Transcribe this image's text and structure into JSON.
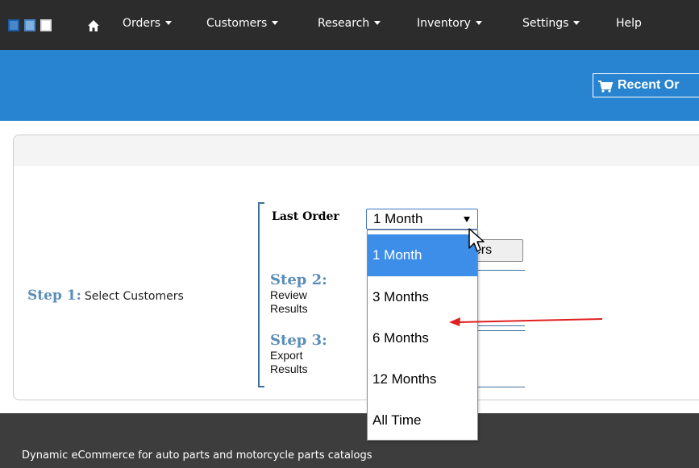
{
  "nav": {
    "items": [
      {
        "label": "Orders",
        "has_caret": true
      },
      {
        "label": "Customers",
        "has_caret": true
      },
      {
        "label": "Research",
        "has_caret": true
      },
      {
        "label": "Inventory",
        "has_caret": true
      },
      {
        "label": "Settings",
        "has_caret": true
      },
      {
        "label": "Help",
        "has_caret": false
      }
    ],
    "icons": {
      "logo": "logo-squares-icon",
      "home": "home-icon"
    }
  },
  "banner": {
    "recent_orders_label": "Recent Or",
    "icon": "cart-icon"
  },
  "steps": {
    "step1": {
      "title": "Step 1:",
      "text": "Select Customers"
    },
    "step2": {
      "title": "Step 2:",
      "line1": "Review",
      "line2": "Results"
    },
    "step3": {
      "title": "Step 3:",
      "line1": "Export",
      "line2": "Results"
    }
  },
  "filter": {
    "label": "Last Order",
    "selected": "1 Month",
    "options": [
      "1 Month",
      "3 Months",
      "6 Months",
      "12 Months",
      "All Time"
    ]
  },
  "hidden_button_label": "ners",
  "footer": {
    "text": "Dynamic eCommerce for auto parts and motorcycle parts catalogs"
  },
  "colors": {
    "topnav": "#2c2c2c",
    "banner": "#2884d0",
    "step_title": "#5b8db8",
    "dropdown_selected": "#3d8ee9",
    "annotation_arrow": "#e02020",
    "footer": "#3d3d3d"
  }
}
